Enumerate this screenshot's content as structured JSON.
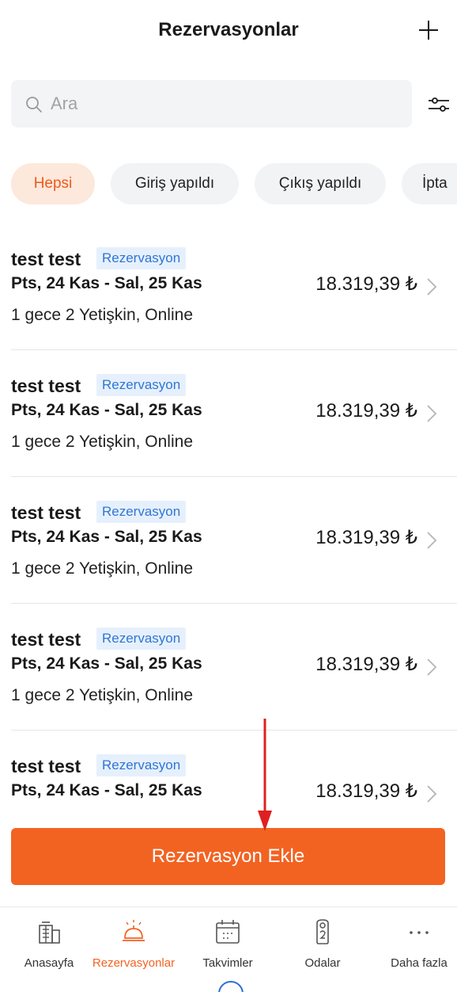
{
  "header": {
    "title": "Rezervasyonlar",
    "add_icon": "plus-icon"
  },
  "search": {
    "placeholder": "Ara",
    "value": ""
  },
  "chips": [
    "Hepsi",
    "Giriş yapıldı",
    "Çıkış yapıldı",
    "İpta"
  ],
  "rows": [
    {
      "name": "test test",
      "badge": "Rezervasyon",
      "dates": "Pts, 24 Kas - Sal, 25 Kas",
      "price": "18.319,39 ₺",
      "details": "1 gece 2 Yetişkin, Online"
    },
    {
      "name": "test test",
      "badge": "Rezervasyon",
      "dates": "Pts, 24 Kas - Sal, 25 Kas",
      "price": "18.319,39 ₺",
      "details": "1 gece 2 Yetişkin, Online"
    },
    {
      "name": "test test",
      "badge": "Rezervasyon",
      "dates": "Pts, 24 Kas - Sal, 25 Kas",
      "price": "18.319,39 ₺",
      "details": "1 gece 2 Yetişkin, Online"
    },
    {
      "name": "test test",
      "badge": "Rezervasyon",
      "dates": "Pts, 24 Kas - Sal, 25 Kas",
      "price": "18.319,39 ₺",
      "details": "1 gece 2 Yetişkin, Online"
    },
    {
      "name": "test test",
      "badge": "Rezervasyon",
      "dates": "Pts, 24 Kas - Sal, 25 Kas",
      "price": "18.319,39 ₺",
      "details": ""
    }
  ],
  "cta": {
    "label": "Rezervasyon Ekle",
    "color": "#f26322"
  },
  "tabs": [
    {
      "label": "Anasayfa",
      "icon": "building-icon"
    },
    {
      "label": "Rezervasyonlar",
      "icon": "reception-bell-icon"
    },
    {
      "label": "Takvimler",
      "icon": "calendar-icon"
    },
    {
      "label": "Odalar",
      "icon": "door-hanger-icon"
    },
    {
      "label": "Daha fazla",
      "icon": "more-icon"
    }
  ],
  "colors": {
    "accent": "#f26322",
    "badge_text": "#2f76d4",
    "badge_bg": "#e6f0fd",
    "annotation_arrow": "#e02020"
  }
}
